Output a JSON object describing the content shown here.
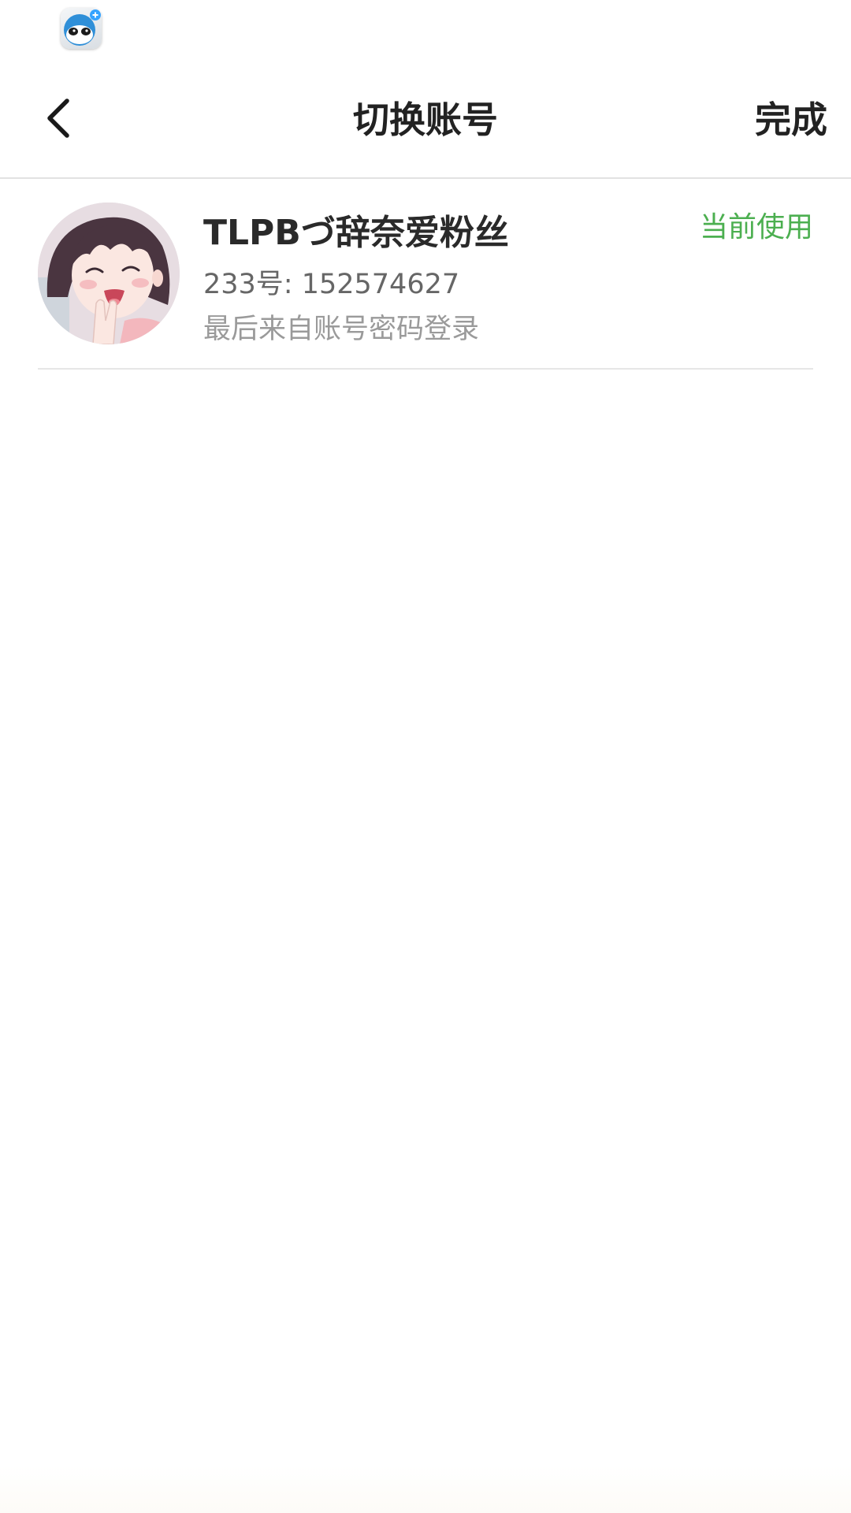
{
  "status_bar": {
    "notification_icon": "app-notification-icon"
  },
  "nav": {
    "back_icon": "chevron-left-icon",
    "title": "切换账号",
    "done_label": "完成"
  },
  "accounts": [
    {
      "name": "TLPBづ辞奈爱粉丝",
      "id_text": "233号: 152574627",
      "login_source": "最后来自账号密码登录",
      "status": "当前使用",
      "status_color": "#4caf50",
      "avatar": "anime-girl-avatar"
    }
  ],
  "colors": {
    "accent_green": "#4caf50",
    "title_text": "#222222",
    "secondary_text": "#666666",
    "tertiary_text": "#9a9a9a",
    "divider": "#e2e2e2"
  }
}
